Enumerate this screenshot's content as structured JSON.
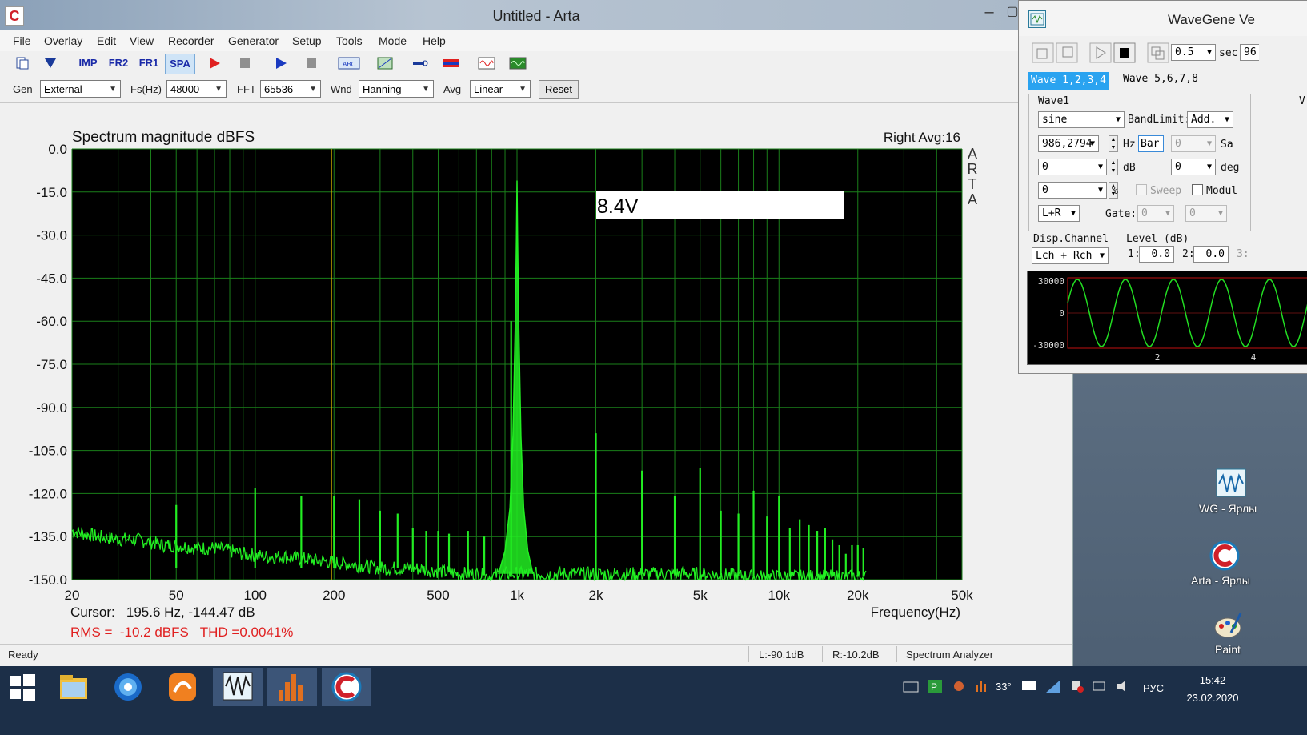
{
  "arta": {
    "title": "Untitled - Arta",
    "app_icon_glyph": "C",
    "menu": [
      "File",
      "Overlay",
      "Edit",
      "View",
      "Recorder",
      "Generator",
      "Setup",
      "Tools",
      "Mode",
      "Help"
    ],
    "toolbar": {
      "imp": "IMP",
      "fr2": "FR2",
      "fr1": "FR1",
      "spa": "SPA"
    },
    "genbar": {
      "gen_label": "Gen",
      "gen_value": "External",
      "fs_label": "Fs(Hz)",
      "fs_value": "48000",
      "fft_label": "FFT",
      "fft_value": "65536",
      "wnd_label": "Wnd",
      "wnd_value": "Hanning",
      "avg_label": "Avg",
      "avg_value": "Linear",
      "reset_label": "Reset"
    },
    "status": {
      "ready": "Ready",
      "left": "L:-90.1dB",
      "right": "R:-10.2dB",
      "mode": "Spectrum Analyzer"
    }
  },
  "plot": {
    "title": "Spectrum magnitude dBFS",
    "channel_info": "Right  Avg:16",
    "brand_letters": [
      "A",
      "R",
      "T",
      "A"
    ],
    "annotation": "8.4V",
    "cursor_text": "Cursor:   195.6 Hz, -144.47 dB",
    "rms_text": "RMS =  -10.2 dBFS   THD =0.0041%",
    "xlabel": "Frequency(Hz)",
    "colors": {
      "background": "#000000",
      "grid": "#1a7f1a",
      "trace": "#22ee22",
      "cursor": "#d4b000",
      "rms_text": "#e02020"
    }
  },
  "chart_data": {
    "type": "line",
    "title": "Spectrum magnitude dBFS",
    "xlabel": "Frequency(Hz)",
    "ylabel": "",
    "x_scale": "log",
    "xlim": [
      20,
      50000
    ],
    "ylim": [
      -150,
      0
    ],
    "x_ticks": [
      "20",
      "50",
      "100",
      "200",
      "500",
      "1k",
      "2k",
      "5k",
      "10k",
      "20k",
      "50k"
    ],
    "x_tick_values": [
      20,
      50,
      100,
      200,
      500,
      1000,
      2000,
      5000,
      10000,
      20000,
      50000
    ],
    "y_ticks": [
      "0.0",
      "-15.0",
      "-30.0",
      "-45.0",
      "-60.0",
      "-75.0",
      "-90.0",
      "-105.0",
      "-120.0",
      "-135.0",
      "-150.0"
    ],
    "y_tick_values": [
      0,
      -15,
      -30,
      -45,
      -60,
      -75,
      -90,
      -105,
      -120,
      -135,
      -150
    ],
    "grid": true,
    "cursor_x": 195.6,
    "noise_floor": [
      [
        20,
        -133
      ],
      [
        25,
        -135
      ],
      [
        30,
        -136
      ],
      [
        35,
        -136
      ],
      [
        40,
        -137
      ],
      [
        45,
        -138
      ],
      [
        50,
        -138
      ],
      [
        60,
        -139
      ],
      [
        70,
        -139
      ],
      [
        80,
        -140
      ],
      [
        90,
        -141
      ],
      [
        110,
        -142
      ],
      [
        130,
        -142
      ],
      [
        160,
        -143
      ],
      [
        200,
        -144
      ],
      [
        250,
        -145
      ],
      [
        300,
        -146
      ],
      [
        400,
        -146
      ],
      [
        500,
        -147
      ],
      [
        600,
        -148
      ],
      [
        700,
        -148
      ],
      [
        800,
        -149
      ],
      [
        850,
        -148
      ],
      [
        1100,
        -148
      ],
      [
        1200,
        -148
      ],
      [
        1500,
        -148
      ],
      [
        2000,
        -148
      ],
      [
        3000,
        -148
      ],
      [
        5000,
        -148
      ],
      [
        8000,
        -149
      ],
      [
        10000,
        -149
      ],
      [
        15000,
        -149
      ],
      [
        20000,
        -149
      ],
      [
        21500,
        -149
      ]
    ],
    "main_peak": {
      "x": 1000,
      "y": -11
    },
    "harmonics": [
      [
        50,
        -124
      ],
      [
        100,
        -118
      ],
      [
        150,
        -121
      ],
      [
        200,
        -121
      ],
      [
        250,
        -122
      ],
      [
        300,
        -126
      ],
      [
        350,
        -127
      ],
      [
        400,
        -132
      ],
      [
        450,
        -133
      ],
      [
        500,
        -133
      ],
      [
        550,
        -134
      ],
      [
        650,
        -133
      ],
      [
        750,
        -135
      ],
      [
        950,
        -60
      ],
      [
        2000,
        -99
      ],
      [
        3000,
        -112
      ],
      [
        4000,
        -121
      ],
      [
        5000,
        -111
      ],
      [
        6000,
        -126
      ],
      [
        7000,
        -127
      ],
      [
        8000,
        -119
      ],
      [
        9000,
        -128
      ],
      [
        10000,
        -121
      ],
      [
        11000,
        -132
      ],
      [
        12000,
        -129
      ],
      [
        13000,
        -131
      ],
      [
        14000,
        -133
      ],
      [
        15000,
        -132
      ],
      [
        16000,
        -136
      ],
      [
        17000,
        -138
      ],
      [
        18000,
        -141
      ],
      [
        19000,
        -138
      ],
      [
        20000,
        -138
      ],
      [
        21000,
        -139
      ]
    ]
  },
  "wavegene": {
    "title": "WaveGene Ve",
    "toolbar_value": "0.5",
    "toolbar_unit": "sec",
    "toolbar_extra": "96",
    "tab1": "Wave 1,2,3,4",
    "tab2": "Wave 5,6,7,8",
    "wave1_label": "Wave1",
    "side_v": "V",
    "wave_type": "sine",
    "bandlimit_label": "BandLimit:",
    "bandlimit_value": "Add.",
    "freq_value": "986,2794",
    "hz_label": "Hz",
    "bar_label": "Bar",
    "sa_value": "0",
    "sa_label": "Sa",
    "db_value": "0",
    "db_label": "dB",
    "deg_value": "0",
    "deg_label": "deg",
    "pct_value": "0",
    "pct_label": "%",
    "sweep_label": "Sweep",
    "modul_label": "Modul",
    "lr_value": "L+R",
    "gate_label": "Gate:",
    "gate1": "0",
    "gate2": "0",
    "disp_channel_label": "Disp.Channel",
    "level_label": "Level (dB)",
    "disp_channel_value": "Lch + Rch",
    "level1_label": "1:",
    "level1_value": "0.0",
    "level2_label": "2:",
    "level2_value": "0.0",
    "level3_label": "3:",
    "scope_y_top": "30000",
    "scope_y_mid": "0",
    "scope_y_bot": "-30000",
    "scope_x_1": "2",
    "scope_x_2": "4"
  },
  "desktop_icons": [
    {
      "label": "WG - Ярлы"
    },
    {
      "label": "Arta - Ярлы"
    },
    {
      "label": "Paint"
    }
  ],
  "taskbar": {
    "time": "15:42",
    "date": "23.02.2020",
    "lang": "РУС",
    "temp": "33°"
  }
}
